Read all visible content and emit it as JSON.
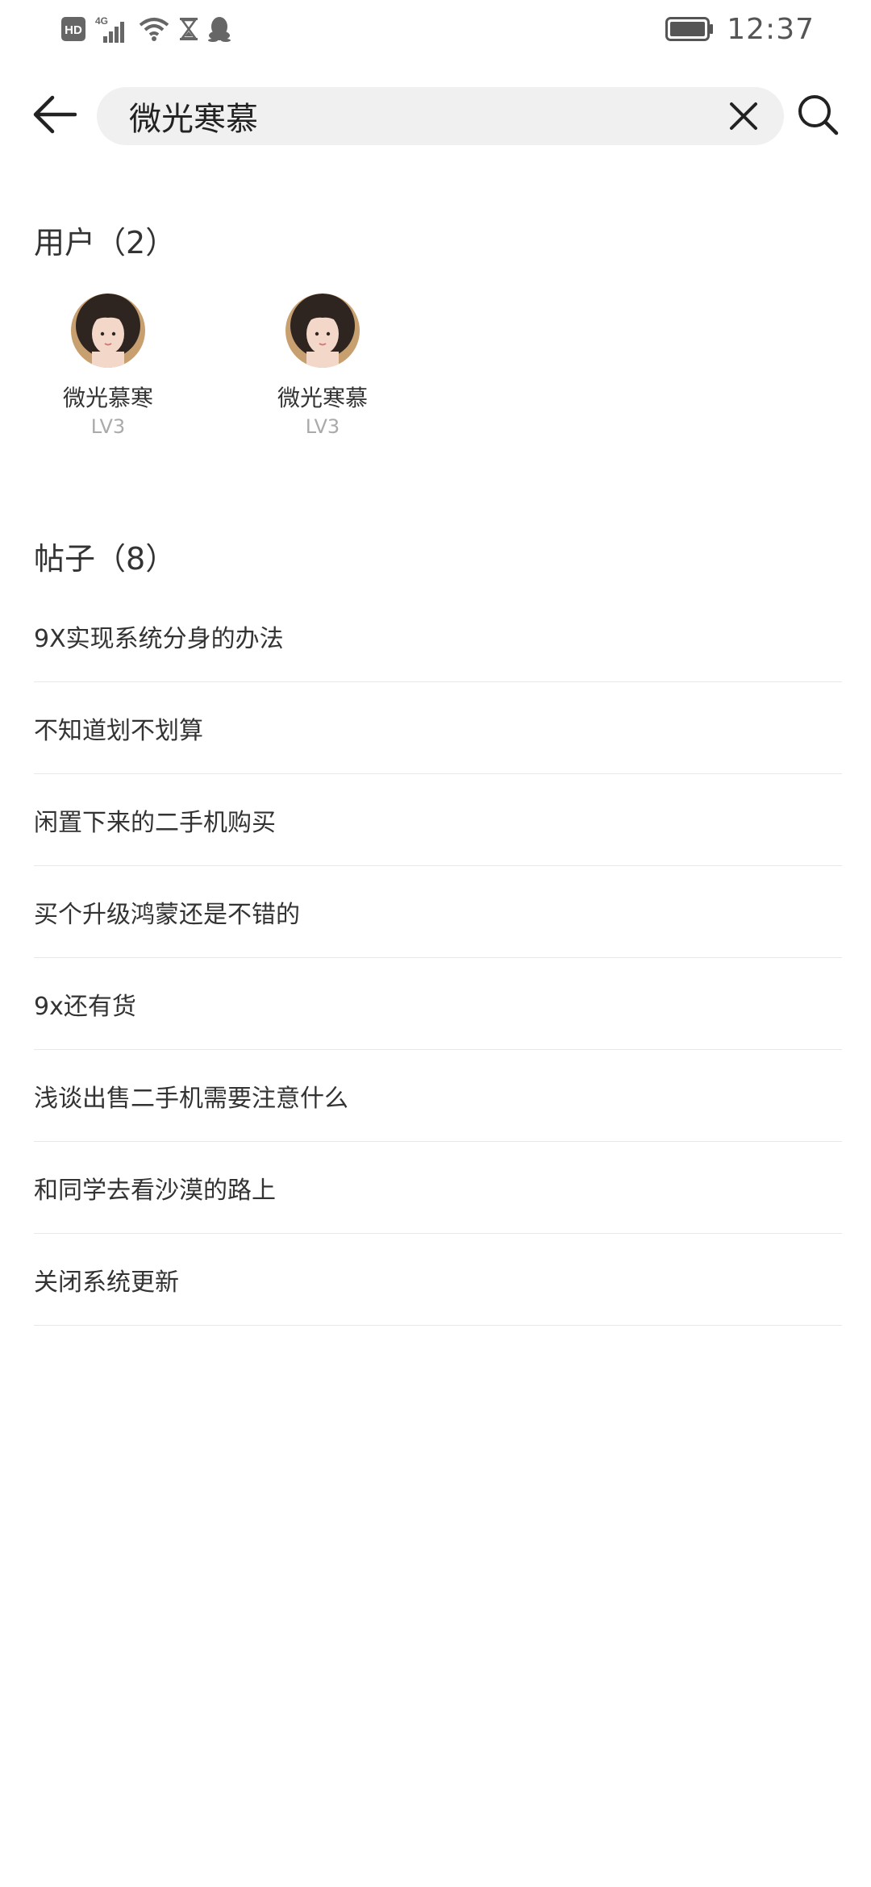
{
  "status_bar": {
    "hd_label": "HD",
    "network_label": "4G",
    "time": "12:37",
    "icons": [
      "hd-icon",
      "signal-icon",
      "wifi-icon",
      "hourglass-icon",
      "qq-penguin-icon",
      "battery-icon"
    ]
  },
  "search": {
    "query": "微光寒慕",
    "back_icon": "back-arrow-icon",
    "clear_icon": "close-icon",
    "search_icon": "search-icon"
  },
  "users_section": {
    "title": "用户",
    "count": "（2）",
    "users": [
      {
        "name": "微光慕寒",
        "level": "LV3"
      },
      {
        "name": "微光寒慕",
        "level": "LV3"
      }
    ]
  },
  "posts_section": {
    "title": "帖子",
    "count": "（8）",
    "posts": [
      "9X实现系统分身的办法",
      "不知道划不划算",
      "闲置下来的二手机购买",
      "买个升级鸿蒙还是不错的",
      "9x还有货",
      "浅谈出售二手机需要注意什么",
      "和同学去看沙漠的路上",
      "关闭系统更新"
    ]
  },
  "colors": {
    "background": "#ffffff",
    "search_bg": "#f0f0f0",
    "primary_text": "#333333",
    "secondary_text": "#aaaaaa",
    "divider": "#e8e8e8"
  }
}
